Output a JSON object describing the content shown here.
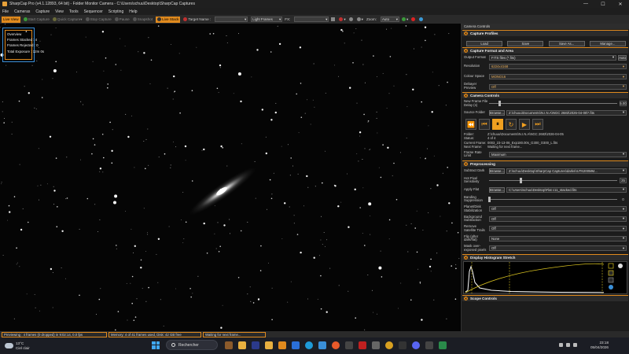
{
  "window": {
    "title": "SharpCap Pro (v4.1.12893, 64 bit) - Folder Monitor Camera - C:\\Users\\schuu\\Desktop\\SharpCap Captures",
    "controls": [
      "—",
      "☐",
      "✕"
    ]
  },
  "menu": [
    "File",
    "Cameras",
    "Capture",
    "View",
    "Tools",
    "Sequencer",
    "Scripting",
    "Help"
  ],
  "toolbar": {
    "live_view": "Live View",
    "start_capture": "Start Capture",
    "quick_capture": "Quick Capture",
    "stop_capture": "Stop Capture",
    "pause": "Pause",
    "snapshot": "Snapshot",
    "live_stack": "Live Stack",
    "target_name_label": "Target Name :",
    "target_name_value": "",
    "frame_type_value": "Light Frames",
    "fx_label": "FX:",
    "fx_value": "",
    "zoom_label": "Zoom:",
    "zoom_value": "Auto"
  },
  "overview": {
    "title": "Overview",
    "frames_stacked": "Frames Stacked : 4",
    "frames_rejected": "Frames Rejected : 0",
    "total_exposure": "Total Exposure :   12m 0s"
  },
  "panel": {
    "title": "Camera Controls",
    "capture_profiles": {
      "title": "Capture Profiles",
      "buttons": [
        "Load",
        "Save",
        "Save As...",
        "Manage..."
      ]
    },
    "capture_format": {
      "title": "Capture Format and Area",
      "output_format_label": "Output Format",
      "output_format_value": "FITS files (*.fits)",
      "auto_label": "Auto",
      "resolution_label": "Resolution",
      "resolution_value": "6224x4168",
      "colour_space_label": "Colour Space",
      "colour_space_value": "MONO16",
      "debayer_label": "Debayer Preview",
      "debayer_value": "Off"
    },
    "camera_controls": {
      "title": "Camera Controls",
      "new_frame_delay_label": "New Frame File Delay (s)",
      "new_frame_delay_value": "5.00",
      "new_frame_delay_level": 0.08,
      "source_folder_label": "Source Folder",
      "browse_label": "Browse...",
      "source_folder_value": "Z:\\chuuu\\Documents\\N.I.N.A\\NGC 2683\\2026-04-05\\*.fits",
      "playback_active_index": 2,
      "folder_label": "Folder:",
      "folder_value": "Z:\\chuuu\\Documents\\N.I.N.A\\NGC 2683\\2026-04-05",
      "status_label": "Status:",
      "status_value": "4 of 4",
      "current_frame_label": "Current Frame:",
      "current_frame_value": "0003_23-13-06_Exp180.00s_G300_O300_L.fits",
      "next_frame_label": "Next Frame:",
      "next_frame_value": "Waiting for next frame...",
      "frame_rate_label": "Frame Rate Limit",
      "frame_rate_value": "Maximum"
    },
    "preprocessing": {
      "title": "Preprocessing",
      "subtract_dark_label": "Subtract Dark",
      "browse_label": "Browse...",
      "subtract_dark_value": "Z:\\schuu\\Desktop\\SharpCap Captures\\darks\\IUT6200MM...",
      "hot_pixel_label": "Hot Pixel Sensitivity",
      "hot_pixel_value": "25",
      "hot_pixel_level": 0.25,
      "apply_flat_label": "Apply Flat",
      "apply_flat_value": "C:\\Users\\schuu\\Desktop\\Flat c11_stacked.fits",
      "banding_label": "Banding Suppression",
      "banding_value": "0",
      "banding_level": 0.0,
      "planet_disk_label": "Planet/Disk Stabilization",
      "planet_disk_value": "Off",
      "background_sub_label": "Background Subtraction",
      "background_sub_value": "Off",
      "remove_satellite_label": "Remove Satellite Trails",
      "remove_satellite_value": "Off",
      "flip_label": "Flip (after dark/flat)",
      "flip_value": "None",
      "mask_label": "Mask over-exposed pixels",
      "mask_value": "Off"
    },
    "histogram": {
      "title": "Display Histogram Stretch"
    },
    "scope_controls": {
      "title": "Scope Controls"
    }
  },
  "statusbar": {
    "previewing": "Previewing : 4 frames (0 dropped) in 9:02:14, 0.0 fps",
    "memory": "Memory: 4 of 41 frames used, Disk: 42 GB free",
    "waiting": "Waiting for next frame..."
  },
  "taskbar": {
    "temp": "13°C",
    "weather": "Ciel clair",
    "search_placeholder": "Rechercher",
    "time": "23:18",
    "date": "05/04/2026"
  },
  "colors": {
    "accent": "#e08a1e",
    "overview_border": "#3a8fd8",
    "hist_curve": "#d6c020"
  }
}
